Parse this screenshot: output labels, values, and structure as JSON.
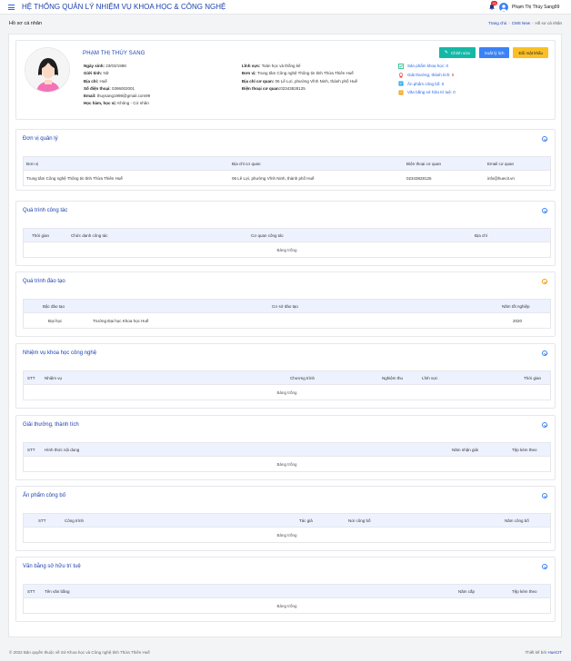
{
  "header": {
    "title": "HỆ THỐNG QUẢN LÝ NHIỆM VỤ KHOA HỌC & CÔNG NGHỆ",
    "notification_count": "21",
    "user_name": "Phạm Thị Thúy Sang99"
  },
  "page": {
    "title": "Hồ sơ cá nhân",
    "breadcrumb": [
      "Trang chủ",
      "CMS New",
      "Hồ sơ cá nhân"
    ]
  },
  "profile": {
    "name": "PHẠM THỊ THÚY SANG",
    "fields_left": [
      {
        "label": "Ngày sinh:",
        "value": "23/03/1998"
      },
      {
        "label": "Giới tính:",
        "value": "Nữ"
      },
      {
        "label": "Địa chỉ:",
        "value": "Huế"
      },
      {
        "label": "Số điện thoại:",
        "value": "0396002001"
      },
      {
        "label": "Email:",
        "value": "thuysang1998@gmail.com99"
      },
      {
        "label": "Học hàm, học vị:",
        "value": "Không - Cử nhân"
      }
    ],
    "fields_right": [
      {
        "label": "Lĩnh vực:",
        "value": "Toán học và thống kê"
      },
      {
        "label": "Đơn vị:",
        "value": "Trung tâm Công nghệ Thông tin tỉnh Thừa Thiên Huế"
      },
      {
        "label": "Địa chỉ cơ quan:",
        "value": "06 Lê Lợi, phường Vĩnh Ninh, thành phố Huế"
      },
      {
        "label": "Điện thoại cơ quan:",
        "value": "02343828125"
      }
    ],
    "stats": [
      {
        "label": "Sản phẩm khoa học:",
        "value": "0",
        "icon": "book-icon",
        "color": "#10b981"
      },
      {
        "label": "Giải thưởng, thành tích:",
        "value": "0",
        "icon": "award-icon",
        "color": "#ef4444"
      },
      {
        "label": "Ấn phẩm công bố:",
        "value": "0",
        "icon": "publication-icon",
        "color": "#0ea5e9"
      },
      {
        "label": "Văn bằng sở hữu trí tuệ:",
        "value": "0",
        "icon": "certificate-icon",
        "color": "#f59e0b"
      }
    ],
    "buttons": {
      "edit": "Chỉnh sửa",
      "export": "Xuất lý lịch",
      "change_password": "Đổi mật khẩu"
    }
  },
  "sections": {
    "units": {
      "title": "Đơn vị quản lý",
      "columns": [
        "Đơn vị",
        "Địa chỉ cơ quan",
        "Điện thoại cơ quan",
        "Email cơ quan"
      ],
      "row": [
        "Trung tâm Công nghệ Thông tin tỉnh Thừa Thiên Huế",
        "06 Lê Lợi, phường Vĩnh Ninh, thành phố Huế",
        "02343828125",
        "info@huecit.vn"
      ]
    },
    "work": {
      "title": "Quá trình công tác",
      "columns": [
        "Thời gian",
        "Chức danh công tác",
        "Cơ quan công tác",
        "Địa chỉ"
      ],
      "empty": "Bảng trống"
    },
    "education": {
      "title": "Quá trình đào tạo",
      "columns": [
        "Bậc đào tạo",
        "Cơ sở đào tạo",
        "Năm tốt nghiệp"
      ],
      "row": [
        "Đại học",
        "Trường Đại học Khoa học Huế",
        "2020"
      ]
    },
    "tasks": {
      "title": "Nhiệm vụ khoa học công nghệ",
      "columns": [
        "STT",
        "Nhiệm vụ",
        "Chương trình",
        "Nghiệm thu",
        "Lĩnh vực",
        "Thời gian"
      ],
      "empty": "Bảng trống"
    },
    "awards": {
      "title": "Giải thưởng, thành tích",
      "columns": [
        "STT",
        "Hình thức nội dung",
        "Năm nhận giải",
        "Tệp kèm theo"
      ],
      "empty": "Bảng trống"
    },
    "publications": {
      "title": "Ấn phẩm công bố",
      "columns": [
        "STT",
        "Công trình",
        "Tác giả",
        "Nơi công bố",
        "Năm công bố"
      ],
      "empty": "Bảng trống"
    },
    "patents": {
      "title": "Văn bằng sở hữu trí tuệ",
      "columns": [
        "STT",
        "Tên văn bằng",
        "Năm cấp",
        "Tệp kèm theo"
      ],
      "empty": "Bảng trống"
    }
  },
  "footer": {
    "copyright": "© 2022 Bản quyền thuộc về Sở Khoa học và Công nghệ tỉnh Thừa Thiên Huế",
    "designed_by": "Thiết kế bởi",
    "designer": "HueCIT"
  }
}
